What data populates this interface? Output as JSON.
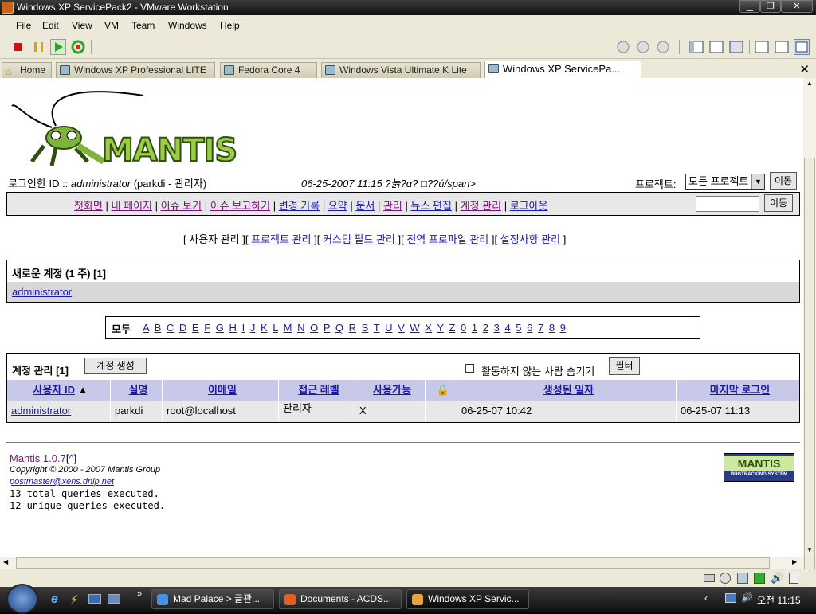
{
  "window": {
    "title": "Windows XP ServicePack2 - VMware Workstation"
  },
  "menu": [
    "File",
    "Edit",
    "View",
    "VM",
    "Team",
    "Windows",
    "Help"
  ],
  "tabs": [
    {
      "label": "Home"
    },
    {
      "label": "Windows XP Professional LITE"
    },
    {
      "label": "Fedora Core 4"
    },
    {
      "label": "Windows Vista Ultimate K Lite"
    },
    {
      "label": "Windows XP ServicePa..."
    }
  ],
  "mantis": {
    "logo_text": "MANTIS",
    "login_label": "로그인한 ID ::",
    "login_user": "administrator",
    "login_detail": "(parkdi - 관리자)",
    "datetime": "06-25-2007 11:15 ?놁?α? □??ú/span>",
    "project_label": "프로젝트:",
    "project_selected": "모든 프로젝트",
    "go_button": "이동",
    "nav": [
      "첫화면",
      "내 페이지",
      "이슈 보기",
      "이슈 보고하기",
      "변경 기록",
      "요약",
      "문서",
      "관리",
      "뉴스 편집",
      "계정 관리",
      "로그아웃"
    ],
    "nav_sep": "|",
    "search_go": "이동",
    "submenu_current": "사용자 관리",
    "submenu_links": [
      "프로젝트 관리",
      "커스텀 필드 관리",
      "전역 프로파일 관리",
      "설정사항 관리"
    ],
    "new_accounts_title": "새로운 계정 (1 주) [1]",
    "new_accounts_user": "administrator",
    "filter_all": "모두",
    "letters": [
      "A",
      "B",
      "C",
      "D",
      "E",
      "F",
      "G",
      "H",
      "I",
      "J",
      "K",
      "L",
      "M",
      "N",
      "O",
      "P",
      "Q",
      "R",
      "S",
      "T",
      "U",
      "V",
      "W",
      "X",
      "Y",
      "Z",
      "0",
      "1",
      "2",
      "3",
      "4",
      "5",
      "6",
      "7",
      "8",
      "9"
    ],
    "manage_title": "계정 관리 [1]",
    "create_button": "계정 생성",
    "hide_inactive_label": "활동하지 않는 사람 숨기기",
    "filter_button": "필터",
    "columns": [
      "사용자 ID",
      "실명",
      "이메일",
      "접근 레벨",
      "사용가능",
      "",
      "생성된 일자",
      "마지막 로그인"
    ],
    "row": {
      "username": "administrator",
      "realname": "parkdi",
      "email": "root@localhost",
      "access": "관리자",
      "enabled": "X",
      "protected": "",
      "created": "06-25-07 10:42",
      "last_visit": "06-25-07 11:13"
    },
    "footer": {
      "version": "Mantis 1.0.7",
      "up": "^",
      "copyright": "Copyright © 2000 - 2007 Mantis Group",
      "email": "postmaster@xens.dnip.net",
      "queries1": "13 total queries executed.",
      "queries2": "12 unique queries executed.",
      "badge_top": "MANTIS",
      "badge_bottom": "BUGTRACKING SYSTEM"
    }
  },
  "taskbar": {
    "tasks": [
      "Mad Palace > 글관...",
      "Documents - ACDS...",
      "Windows XP Servic..."
    ],
    "clock": "오전 11:15"
  }
}
